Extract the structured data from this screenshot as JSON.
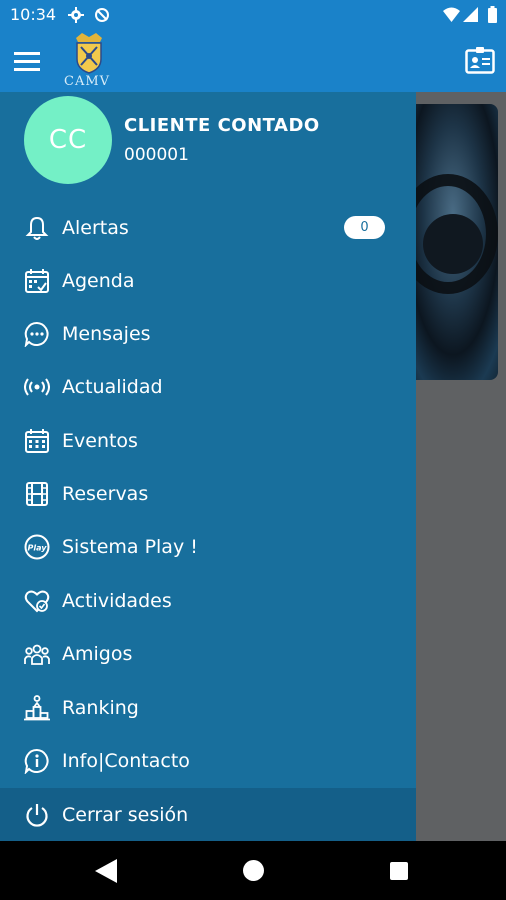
{
  "status_bar": {
    "time": "10:34"
  },
  "app_bar": {
    "logo_text": "CAMV"
  },
  "user": {
    "initials": "CC",
    "name": "CLIENTE CONTADO",
    "id": "000001"
  },
  "menu": {
    "alertas": {
      "label": "Alertas",
      "badge": "0"
    },
    "agenda": {
      "label": "Agenda"
    },
    "mensajes": {
      "label": "Mensajes"
    },
    "actualidad": {
      "label": "Actualidad"
    },
    "eventos": {
      "label": "Eventos"
    },
    "reservas": {
      "label": "Reservas"
    },
    "sistema_play": {
      "label": "Sistema Play !"
    },
    "actividades": {
      "label": "Actividades"
    },
    "amigos": {
      "label": "Amigos"
    },
    "ranking": {
      "label": "Ranking"
    },
    "info_contacto": {
      "label": "Info|Contacto"
    },
    "cerrar_sesion": {
      "label": "Cerrar sesión"
    }
  },
  "icons": {
    "menu": "hamburger-icon",
    "profile_card": "id-card-icon",
    "alertas": "bell-icon",
    "agenda": "calendar-check-icon",
    "mensajes": "chat-bubble-icon",
    "actualidad": "broadcast-icon",
    "eventos": "calendar-grid-icon",
    "reservas": "film-icon",
    "sistema_play": "play-badge-icon",
    "actividades": "heart-check-icon",
    "amigos": "people-icon",
    "ranking": "podium-icon",
    "info_contacto": "info-bubble-icon",
    "cerrar_sesion": "power-icon"
  },
  "colors": {
    "app_bar": "#1a82c9",
    "drawer": "#186f9d",
    "logout_row": "#145f89",
    "avatar": "#74f0c6",
    "scrim": "#5f6163"
  }
}
